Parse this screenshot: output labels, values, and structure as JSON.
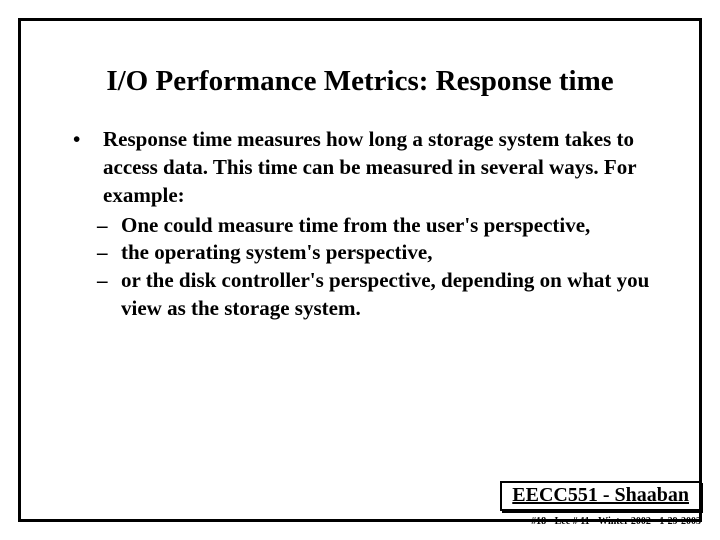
{
  "title": "I/O Performance Metrics: Response time",
  "bullets": [
    {
      "text": "Response time measures how long a storage system takes to access data. This time can be measured in several ways. For example:",
      "sub": [
        "One could measure time from the user's perspective,",
        "the operating system's perspective,",
        "or the disk controller's perspective, depending on what you view as the storage system."
      ]
    }
  ],
  "footer": {
    "course": "EECC551 - Shaaban",
    "page": "#18",
    "lecture": "Lec # 11",
    "term": "Winter 2002",
    "date": "1-29-2003"
  }
}
